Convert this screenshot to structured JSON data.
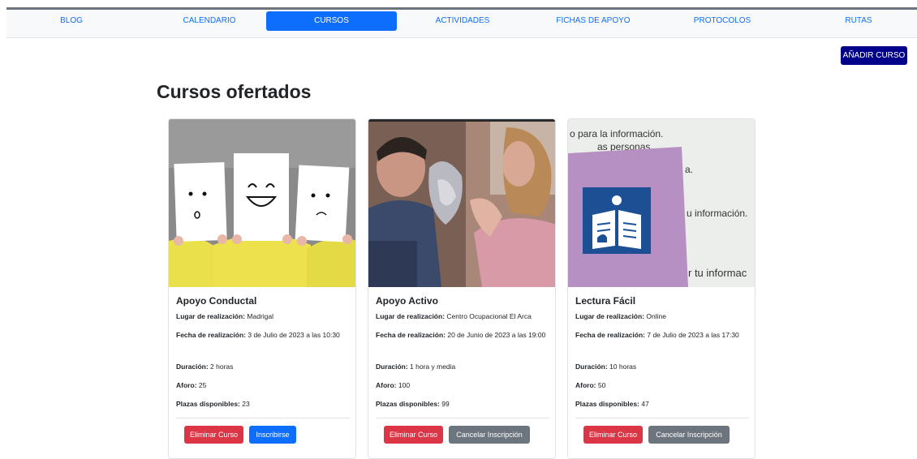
{
  "nav": {
    "items": [
      {
        "label": "BLOG",
        "active": false
      },
      {
        "label": "CALENDARIO",
        "active": false
      },
      {
        "label": "CURSOS",
        "active": true
      },
      {
        "label": "ACTIVIDADES",
        "active": false
      },
      {
        "label": "FICHAS DE APOYO",
        "active": false
      },
      {
        "label": "PROTOCOLOS",
        "active": false
      },
      {
        "label": "RUTAS",
        "active": false
      }
    ]
  },
  "toolbar": {
    "add_course_label": "AÑADIR CURSO"
  },
  "main": {
    "title": "Cursos ofertados"
  },
  "labels": {
    "location": "Lugar de realización:",
    "date": "Fecha de realización:",
    "duration": "Duración:",
    "capacity": "Aforo:",
    "available": "Plazas disponibles:"
  },
  "courses": [
    {
      "title": "Apoyo Conductal",
      "location": "Madrigal",
      "date": "3 de Julio de 2023 a las 10:30",
      "duration": "2 horas",
      "capacity": "25",
      "available": "23",
      "delete_label": "Eliminar Curso",
      "action_label": "Inscribirse"
    },
    {
      "title": "Apoyo Activo",
      "location": "Centro Ocupacional El Arca",
      "date": "20 de Junio de 2023 a las 19:00",
      "duration": "1 hora y media",
      "capacity": "100",
      "available": "99",
      "delete_label": "Eliminar Curso",
      "action_label": "Cancelar Inscripción"
    },
    {
      "title": "Lectura Fácil",
      "location": "Online",
      "date": "7 de Julio de 2023 a las 17:30",
      "duration": "10 horas",
      "capacity": "50",
      "available": "47",
      "delete_label": "Eliminar Curso",
      "action_label": "Cancelar Inscripción"
    }
  ],
  "image_text": {
    "line1": "o para la información.",
    "line2": "as personas",
    "line3": "a.",
    "line4": "u información.",
    "line5": "r tu informac"
  },
  "colors": {
    "primary": "#0d6efd",
    "danger": "#dc3545",
    "secondary": "#6c757d",
    "add_button": "#00008b"
  }
}
